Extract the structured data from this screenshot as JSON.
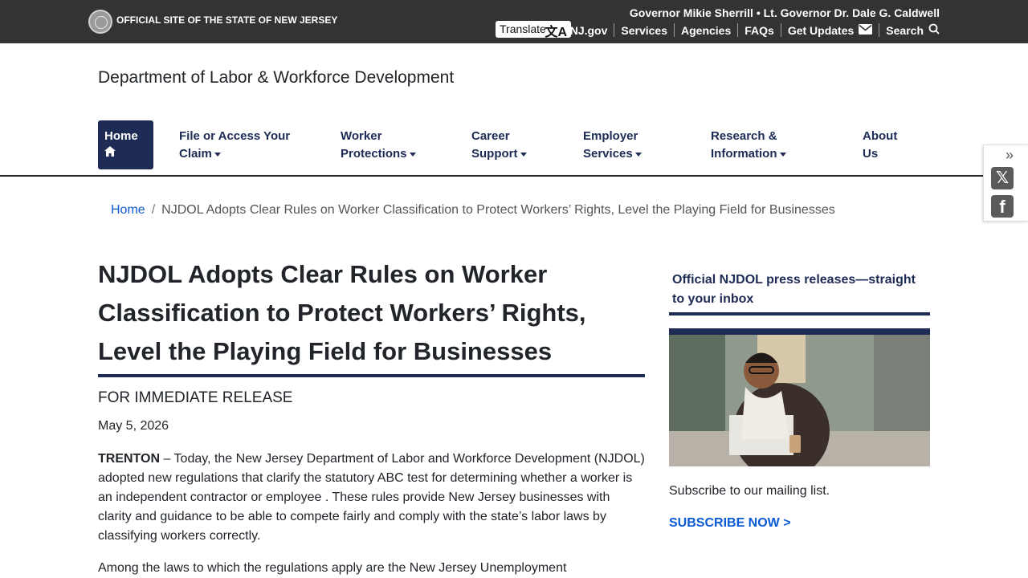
{
  "topbar": {
    "official": "OFFICIAL SITE OF THE STATE OF NEW JERSEY",
    "governor": "Governor Mikie Sherrill • Lt. Governor Dr. Dale G. Caldwell",
    "translate": "Translate",
    "links": [
      {
        "label": "NJ.gov"
      },
      {
        "label": "Services"
      },
      {
        "label": "Agencies"
      },
      {
        "label": "FAQs"
      },
      {
        "label": "Get Updates",
        "icon": "envelope-icon"
      },
      {
        "label": "Search",
        "icon": "search-icon"
      }
    ]
  },
  "header": {
    "department": "Department of Labor & Workforce Development"
  },
  "nav": {
    "home": "Home",
    "items": [
      {
        "line1": "File or Access Your",
        "line2": "Claim"
      },
      {
        "line1": "Worker",
        "line2": "Protections"
      },
      {
        "line1": "Career",
        "line2": "Support"
      },
      {
        "line1": "Employer",
        "line2": "Services"
      },
      {
        "line1": "Research &",
        "line2": "Information"
      },
      {
        "line1": "About",
        "line2": "Us"
      }
    ]
  },
  "breadcrumb": {
    "home": "Home",
    "separator": "/",
    "current": "NJDOL Adopts Clear Rules on Worker Classification to Protect Workers’ Rights, Level the Playing Field for Businesses"
  },
  "article": {
    "title_lines": [
      "NJDOL Adopts Clear Rules on Worker",
      "Classification to Protect Workers’ Rights,",
      "Level the Playing Field for Businesses"
    ],
    "release_label": "FOR IMMEDIATE RELEASE",
    "date": "May 5, 2026",
    "dateline": "TRENTON",
    "p1_rest": " – Today, the New Jersey Department of Labor and Workforce Development (NJDOL) adopted new regulations that clarify the statutory ABC test for determining whether a worker is an independent contractor or employee . These rules provide New Jersey businesses with clarity and guidance to be able to compete fairly and comply with the state’s labor laws by classifying workers correctly.",
    "p2": "Among the laws to which the regulations apply are the New Jersey Unemployment"
  },
  "sidebar": {
    "heading": "Official NJDOL press releases—straight to your inbox",
    "subscribe_text": "Subscribe to our mailing list.",
    "subscribe_button": "SUBSCRIBE NOW >"
  },
  "colors": {
    "navy": "#1d2b55",
    "topbar": "#333333",
    "link": "#0b5ad6"
  }
}
